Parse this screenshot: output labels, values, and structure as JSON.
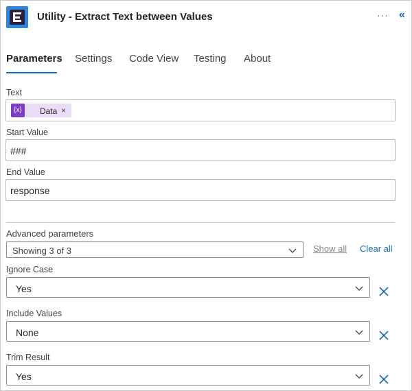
{
  "header": {
    "title": "Utility - Extract Text between Values",
    "more_label": "···",
    "collapse_label": "«"
  },
  "tabs": [
    {
      "label": "Parameters",
      "active": true
    },
    {
      "label": "Settings"
    },
    {
      "label": "Code View"
    },
    {
      "label": "Testing"
    },
    {
      "label": "About"
    }
  ],
  "fields": {
    "text": {
      "label": "Text",
      "token": {
        "icon": "{x}",
        "label": "Data",
        "remove": "×"
      }
    },
    "start_value": {
      "label": "Start Value",
      "value": "###"
    },
    "end_value": {
      "label": "End Value",
      "value": "response"
    }
  },
  "advanced": {
    "label": "Advanced parameters",
    "selected": "Showing 3 of 3",
    "show_all": "Show all",
    "clear_all": "Clear all"
  },
  "options": {
    "ignore_case": {
      "label": "Ignore Case",
      "value": "Yes"
    },
    "include_values": {
      "label": "Include Values",
      "value": "None"
    },
    "trim_result": {
      "label": "Trim Result",
      "value": "Yes"
    }
  },
  "colors": {
    "accent": "#0f6cbd",
    "token_bg": "#e9ddf7",
    "token_icon": "#7c3fc4"
  },
  "icons": {
    "app": "connector-logo-icon",
    "chevron": "chevron-down-icon",
    "remove": "close-icon"
  }
}
